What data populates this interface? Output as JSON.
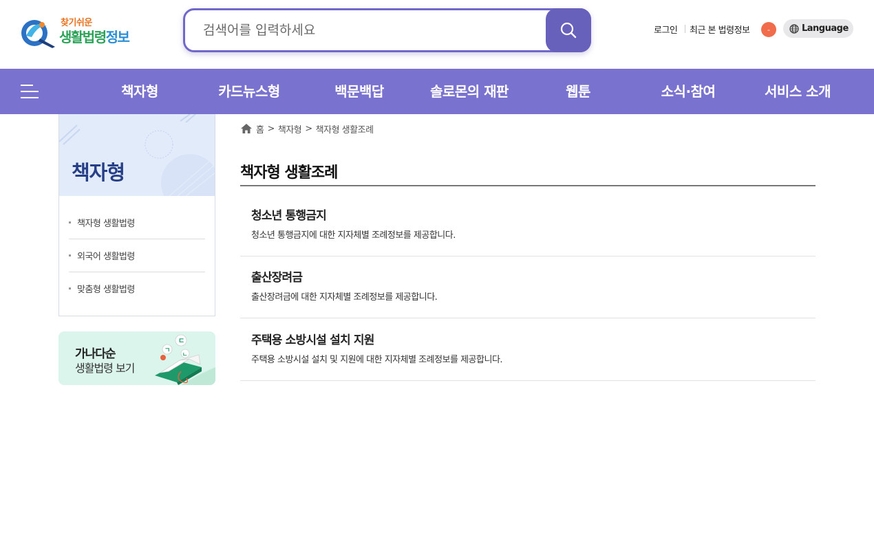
{
  "header": {
    "logo": {
      "tagline": "찾기쉬운",
      "name_part1": "생활법령",
      "name_part2": "정보"
    },
    "search": {
      "placeholder": "검색어를 입력하세요"
    },
    "util": {
      "login": "로그인",
      "recent": "최근 본 법령정보",
      "recent_count": "-",
      "language": "Language"
    }
  },
  "nav": {
    "items": [
      {
        "label": "책자형"
      },
      {
        "label": "카드뉴스형"
      },
      {
        "label": "백문백답"
      },
      {
        "label": "솔로몬의 재판"
      },
      {
        "label": "웹툰"
      },
      {
        "label": "소식·참여"
      },
      {
        "label": "서비스 소개"
      }
    ]
  },
  "sidebar": {
    "title": "책자형",
    "items": [
      {
        "label": "책자형 생활법령"
      },
      {
        "label": "외국어 생활법령"
      },
      {
        "label": "맞춤형 생활법령"
      }
    ],
    "banner": {
      "line1": "가나다순",
      "line2": "생활법령 보기"
    }
  },
  "breadcrumb": [
    "홈",
    "책자형",
    "책자형 생활조례"
  ],
  "breadcrumb_sep": ">",
  "main": {
    "title": "책자형 생활조례",
    "rows": [
      {
        "title": "청소년 통행금지",
        "desc": "청소년 통행금지에 대한 지자체별 조례정보를 제공합니다."
      },
      {
        "title": "출산장려금",
        "desc": "출산장려금에 대한 지자체별 조례정보를 제공합니다."
      },
      {
        "title": "주택용 소방시설 설치 지원",
        "desc": "주택용 소방시설 설치 및 지원에 대한 지자체별 조례정보를 제공합니다."
      }
    ]
  },
  "colors": {
    "primary": "#7a72cf",
    "search_border": "#6f67c9",
    "badge": "#f06c4b",
    "sidebar_title": "#273f86"
  }
}
